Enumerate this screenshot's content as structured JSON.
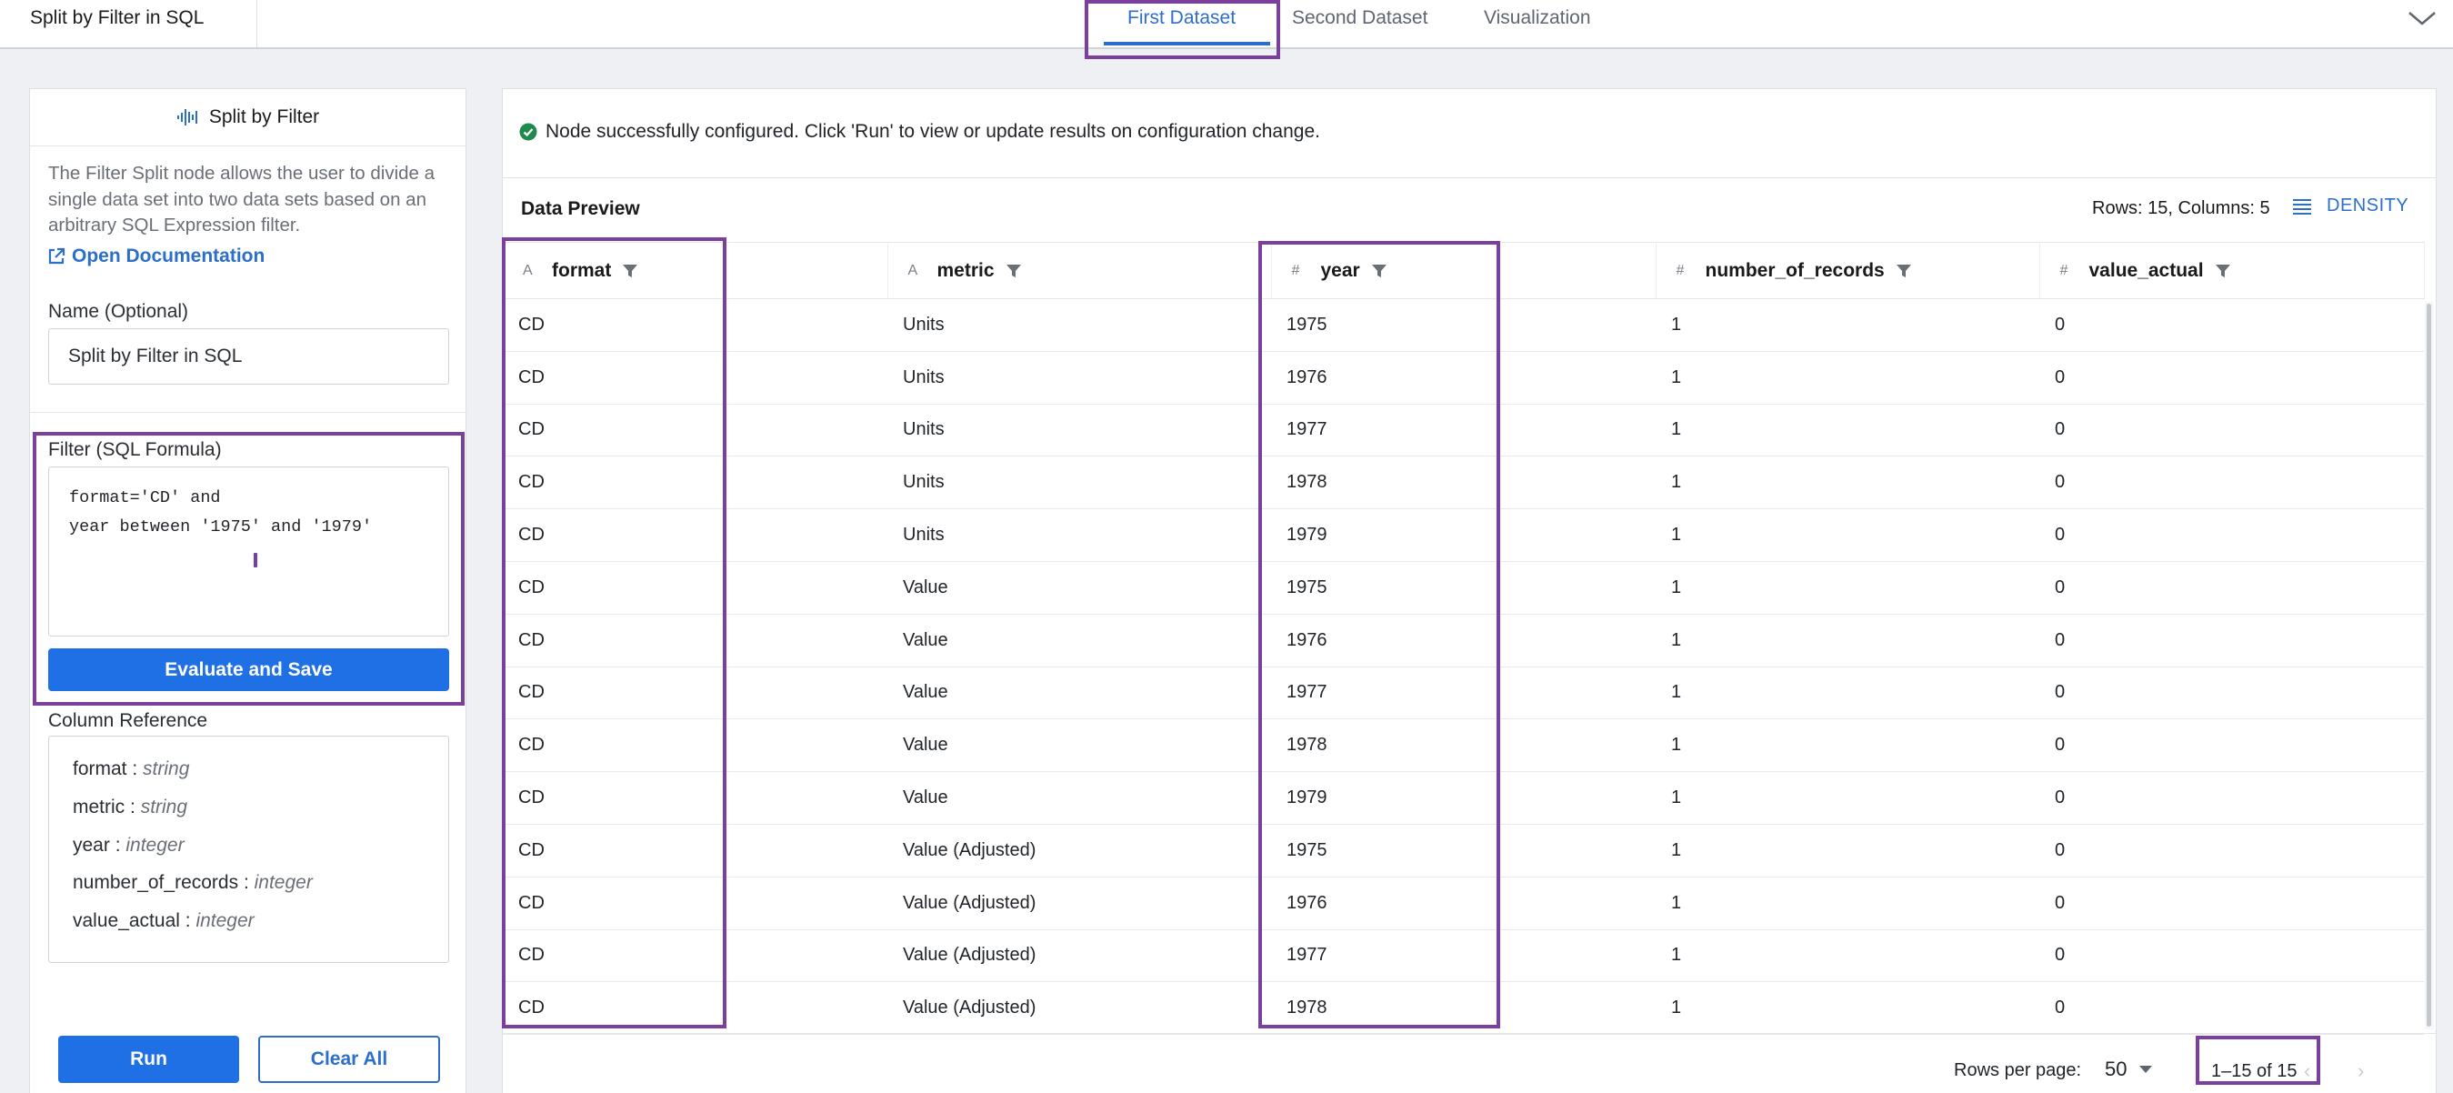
{
  "app": {
    "title": "Split by Filter in SQL"
  },
  "tabs": [
    {
      "label": "First Dataset",
      "active": true
    },
    {
      "label": "Second Dataset",
      "active": false
    },
    {
      "label": "Visualization",
      "active": false
    }
  ],
  "left_panel": {
    "header": "Split by Filter",
    "description": "The Filter Split node allows the user to divide a single data set into two data sets based on an arbitrary SQL Expression filter.",
    "doc_link": "Open Documentation",
    "name_label": "Name (Optional)",
    "name_value": "Split by Filter in SQL",
    "filter_label": "Filter (SQL Formula)",
    "filter_lines": [
      "format='CD' and",
      "year between '1975' and '1979'"
    ],
    "evaluate_button": "Evaluate and Save",
    "column_reference_label": "Column Reference",
    "columns": [
      {
        "name": "format",
        "sep": " : ",
        "type": "string"
      },
      {
        "name": "metric",
        "sep": " : ",
        "type": "string"
      },
      {
        "name": "year",
        "sep": " : ",
        "type": "integer"
      },
      {
        "name": "number_of_records",
        "sep": " : ",
        "type": "integer"
      },
      {
        "name": "value_actual",
        "sep": " : ",
        "type": "integer"
      }
    ],
    "run_button": "Run",
    "clear_button": "Clear All"
  },
  "status": {
    "message": "Node successfully configured. Click 'Run' to view or update results on configuration change."
  },
  "preview": {
    "title": "Data Preview",
    "rows_cols": "Rows: 15, Columns: 5",
    "density_label": "DENSITY",
    "headers": [
      {
        "type": "A",
        "name": "format"
      },
      {
        "type": "A",
        "name": "metric"
      },
      {
        "type": "#",
        "name": "year"
      },
      {
        "type": "#",
        "name": "number_of_records"
      },
      {
        "type": "#",
        "name": "value_actual"
      }
    ],
    "rows": [
      [
        "CD",
        "Units",
        "1975",
        "1",
        "0"
      ],
      [
        "CD",
        "Units",
        "1976",
        "1",
        "0"
      ],
      [
        "CD",
        "Units",
        "1977",
        "1",
        "0"
      ],
      [
        "CD",
        "Units",
        "1978",
        "1",
        "0"
      ],
      [
        "CD",
        "Units",
        "1979",
        "1",
        "0"
      ],
      [
        "CD",
        "Value",
        "1975",
        "1",
        "0"
      ],
      [
        "CD",
        "Value",
        "1976",
        "1",
        "0"
      ],
      [
        "CD",
        "Value",
        "1977",
        "1",
        "0"
      ],
      [
        "CD",
        "Value",
        "1978",
        "1",
        "0"
      ],
      [
        "CD",
        "Value",
        "1979",
        "1",
        "0"
      ],
      [
        "CD",
        "Value (Adjusted)",
        "1975",
        "1",
        "0"
      ],
      [
        "CD",
        "Value (Adjusted)",
        "1976",
        "1",
        "0"
      ],
      [
        "CD",
        "Value (Adjusted)",
        "1977",
        "1",
        "0"
      ],
      [
        "CD",
        "Value (Adjusted)",
        "1978",
        "1",
        "0"
      ]
    ],
    "footer": {
      "rows_per_page_label": "Rows per page:",
      "rows_per_page_value": "50",
      "page_info": "1–15 of 15"
    }
  },
  "colors": {
    "accent": "#2c6ecb",
    "primary_button": "#1f6fe5",
    "highlight": "#7b3f9d",
    "success": "#1e8a4c"
  }
}
